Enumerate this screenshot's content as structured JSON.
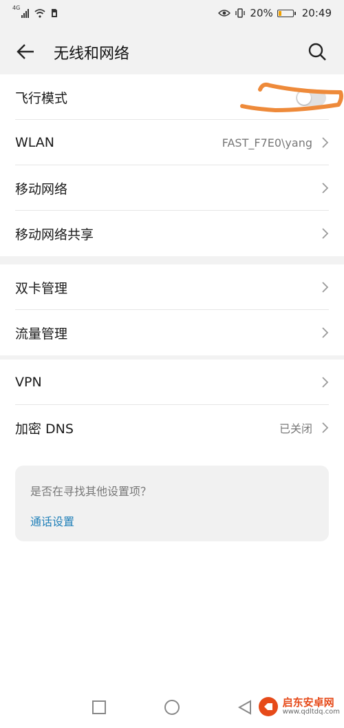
{
  "status_bar": {
    "network": "4G",
    "battery_percent": "20%",
    "time": "20:49"
  },
  "header": {
    "title": "无线和网络"
  },
  "groups": [
    {
      "rows": [
        {
          "label": "飞行模式",
          "type": "toggle",
          "on": false
        },
        {
          "label": "WLAN",
          "value": "FAST_F7E0\\yang"
        },
        {
          "label": "移动网络"
        },
        {
          "label": "移动网络共享"
        }
      ]
    },
    {
      "rows": [
        {
          "label": "双卡管理"
        },
        {
          "label": "流量管理"
        }
      ]
    },
    {
      "rows": [
        {
          "label": "VPN"
        },
        {
          "label": "加密 DNS",
          "value": "已关闭"
        }
      ]
    }
  ],
  "suggestion": {
    "question": "是否在寻找其他设置项？",
    "link": "通话设置"
  },
  "watermark": {
    "brand": "启东安卓网",
    "url": "www.qdltdq.com"
  },
  "colors": {
    "background": "#ffffff",
    "header_bg": "#f2f2f2",
    "link": "#1f7fb8",
    "annotation": "#ee8a3a",
    "battery": "#f0a000"
  }
}
